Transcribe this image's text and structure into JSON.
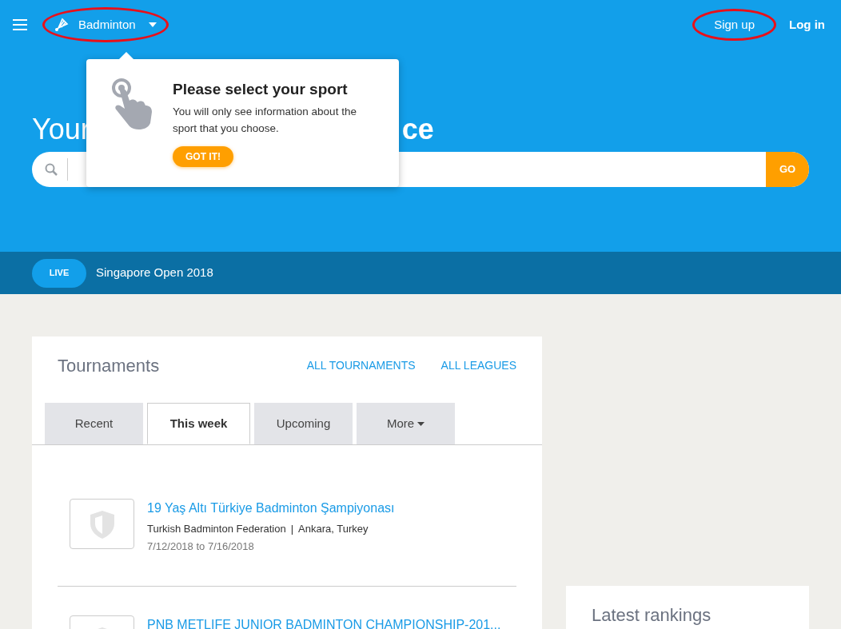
{
  "header": {
    "sport": "Badminton",
    "sign_up": "Sign up",
    "log_in": "Log in"
  },
  "hero": {
    "title_visible_start": "Your",
    "title_visible_end": "ce",
    "search_button": "GO"
  },
  "popup": {
    "title": "Please select your sport",
    "text": "You will only see information about the sport that you choose.",
    "button": "GOT IT!"
  },
  "live_bar": {
    "badge": "LIVE",
    "event": "Singapore Open 2018"
  },
  "tournaments": {
    "title": "Tournaments",
    "links": [
      "ALL TOURNAMENTS",
      "ALL LEAGUES"
    ],
    "tabs": [
      {
        "label": "Recent",
        "selected": false
      },
      {
        "label": "This week",
        "selected": true
      },
      {
        "label": "Upcoming",
        "selected": false
      },
      {
        "label": "More",
        "selected": false,
        "dropdown": true
      }
    ],
    "items": [
      {
        "name": "19 Yaş Altı Türkiye Badminton Şampiyonası",
        "organizer": "Turkish Badminton Federation",
        "separator": "|",
        "location": "Ankara, Turkey",
        "dates": "7/12/2018 to 7/16/2018"
      },
      {
        "name": "PNB METLIFE JUNIOR BADMINTON CHAMPIONSHIP-201..."
      }
    ]
  },
  "rankings": {
    "title": "Latest rankings"
  }
}
